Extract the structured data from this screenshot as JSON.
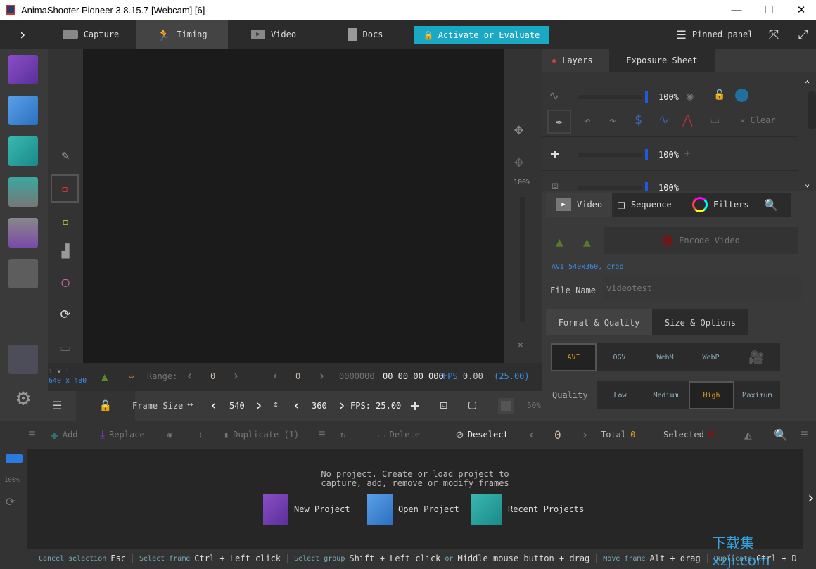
{
  "window": {
    "title": "AnimaShooter Pioneer 3.8.15.7 [Webcam] [6]",
    "min": "—",
    "max": "☐",
    "close": "✕"
  },
  "topbar": {
    "tabs": [
      {
        "label": "Capture"
      },
      {
        "label": "Timing"
      },
      {
        "label": "Video"
      },
      {
        "label": "Docs"
      }
    ],
    "activate": "Activate or Evaluate",
    "pinned": "Pinned panel"
  },
  "info": {
    "grid": "1 x 1",
    "resolution": "640 x 480",
    "range_label": "Range:",
    "range_start": "0",
    "range_end": "0",
    "frame_code": "0000000",
    "timecode": "00 00 00 000",
    "fps_label": "FPS",
    "fps_value": "0.00",
    "fps_target": "(25.00)"
  },
  "framesize": {
    "label": "Frame Size",
    "width": "540",
    "height": "360",
    "fps_label": "FPS:",
    "fps": "25.00",
    "zoom": "50%"
  },
  "rstrip": {
    "zoom": "100%"
  },
  "layers": {
    "tabs": [
      "Layers",
      "Exposure Sheet"
    ],
    "rows": [
      {
        "opacity": "100%"
      },
      {
        "opacity": "100%"
      },
      {
        "opacity": "100%"
      }
    ],
    "clear": "Clear"
  },
  "video_panel": {
    "tabs": [
      "Video",
      "Sequence",
      "Filters"
    ],
    "encode": "Encode Video",
    "format_info": "AVI 540x360,",
    "crop": "crop",
    "file_name_label": "File Name",
    "file_name": "videotest",
    "subtabs": [
      "Format & Quality",
      "Size & Options"
    ],
    "formats": [
      "AVI",
      "OGV",
      "WebM",
      "WebP"
    ],
    "selected_format": "AVI",
    "quality_label": "Quality",
    "qualities": [
      "Low",
      "Medium",
      "High",
      "Maximum"
    ],
    "selected_quality": "High"
  },
  "bottom_toolbar": {
    "add": "Add",
    "replace": "Replace",
    "duplicate": "Duplicate (1)",
    "delete": "Delete",
    "deselect": "Deselect",
    "frame": "0",
    "total_label": "Total",
    "total": "0",
    "selected_label": "Selected",
    "selected": "0"
  },
  "timeline": {
    "zoom": "100%",
    "message_line1": "No project. Create or load project to",
    "message_line2": "capture, add, remove or modify frames",
    "new_project": "New Project",
    "open_project": "Open Project",
    "recent_projects": "Recent Projects"
  },
  "status": [
    {
      "k": "Cancel selection",
      "v": "Esc"
    },
    {
      "k": "Select frame",
      "v": "Ctrl + Left click"
    },
    {
      "k": "Select group",
      "v": "Shift + Left click"
    },
    {
      "k": "or",
      "v": "Middle mouse button + drag"
    },
    {
      "k": "Move frame",
      "v": "Alt + drag"
    },
    {
      "k": "Duplicate",
      "v": "Ctrl + D"
    }
  ],
  "watermark": "下载集 xzji.com",
  "colors": {
    "accent": "#1aa9c5",
    "selected": "#e09a1a",
    "blue": "#3b8ee8"
  }
}
